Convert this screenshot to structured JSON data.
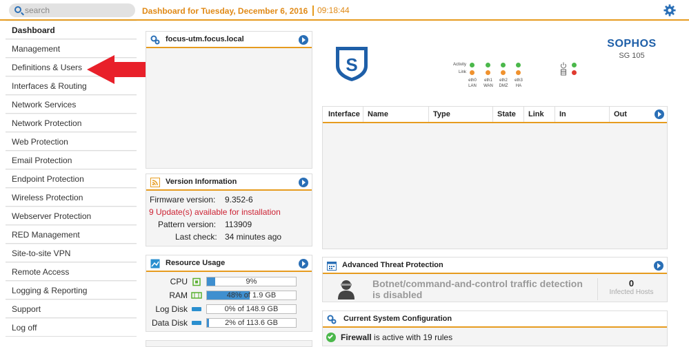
{
  "search": {
    "placeholder": "search"
  },
  "header": {
    "title": "Dashboard for Tuesday, December 6, 2016",
    "time": "09:18:44"
  },
  "sidebar": {
    "items": [
      {
        "label": "Dashboard"
      },
      {
        "label": "Management"
      },
      {
        "label": "Definitions & Users"
      },
      {
        "label": "Interfaces & Routing"
      },
      {
        "label": "Network Services"
      },
      {
        "label": "Network Protection"
      },
      {
        "label": "Web Protection"
      },
      {
        "label": "Email Protection"
      },
      {
        "label": "Endpoint Protection"
      },
      {
        "label": "Wireless Protection"
      },
      {
        "label": "Webserver Protection"
      },
      {
        "label": "RED Management"
      },
      {
        "label": "Site-to-site VPN"
      },
      {
        "label": "Remote Access"
      },
      {
        "label": "Logging & Reporting"
      },
      {
        "label": "Support"
      },
      {
        "label": "Log off"
      }
    ]
  },
  "host_panel": {
    "title": "focus-utm.focus.local"
  },
  "version": {
    "title": "Version Information",
    "firmware_label": "Firmware version:",
    "firmware_value": "9.352-6",
    "updates": "9 Update(s) available for installation",
    "pattern_label": "Pattern version:",
    "pattern_value": "113909",
    "lastcheck_label": "Last check:",
    "lastcheck_value": "34 minutes ago"
  },
  "resources": {
    "title": "Resource Usage",
    "rows": [
      {
        "label": "CPU",
        "text": "9%",
        "percent": 9
      },
      {
        "label": "RAM",
        "text": "48% of 1.9 GB",
        "percent": 48
      },
      {
        "label": "Log Disk",
        "text": "0% of 148.9 GB",
        "percent": 0
      },
      {
        "label": "Data Disk",
        "text": "2% of 113.6 GB",
        "percent": 2
      }
    ]
  },
  "device": {
    "brand": "SOPHOS",
    "model": "SG 105",
    "activity_label": "Activity",
    "link_label": "Link",
    "ports": [
      {
        "name": "eth0",
        "role": "LAN"
      },
      {
        "name": "eth1",
        "role": "WAN"
      },
      {
        "name": "eth2",
        "role": "DMZ"
      },
      {
        "name": "eth3",
        "role": "HA"
      }
    ],
    "colors": {
      "green": "#4bb84b",
      "orange": "#f0922e",
      "red": "#e03a2f"
    }
  },
  "interfaces": {
    "columns": [
      "Interface",
      "Name",
      "Type",
      "State",
      "Link",
      "In",
      "Out"
    ]
  },
  "atp": {
    "title": "Advanced Threat Protection",
    "message": "Botnet/command-and-control traffic detection is disabled",
    "count": "0",
    "count_label": "Infected Hosts"
  },
  "config": {
    "title": "Current System Configuration",
    "item_name": "Firewall",
    "item_text": "is active with 19 rules"
  },
  "colors": {
    "accent": "#e69b1e",
    "blue": "#2a6fb6",
    "arrow": "#e8202a"
  }
}
